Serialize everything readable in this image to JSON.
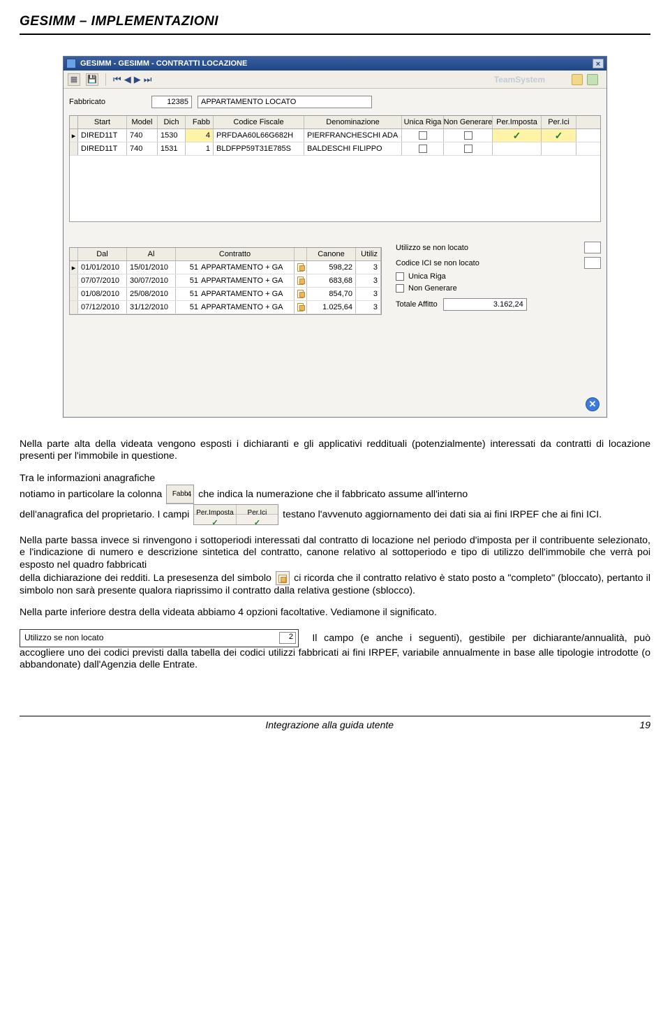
{
  "doc": {
    "header": "GESIMM – IMPLEMENTAZIONI",
    "footer_center": "Integrazione alla guida utente",
    "footer_page": "19"
  },
  "window": {
    "title": "GESIMM - GESIMM - CONTRATTI LOCAZIONE",
    "brand": "TeamSystem",
    "fabbricato_label": "Fabbricato",
    "fabbricato_code": "12385",
    "fabbricato_desc": "APPARTAMENTO LOCATO"
  },
  "grid1": {
    "head": {
      "start": "Start",
      "model": "Model",
      "dich": "Dich",
      "fabb": "Fabb",
      "cf": "Codice Fiscale",
      "denom": "Denominazione",
      "ur": "Unica Riga",
      "ng": "Non Generare",
      "pi": "Per.Imposta",
      "pici": "Per.Ici"
    },
    "rows": [
      {
        "mark": "▸",
        "start": "DIRED11T",
        "model": "740",
        "dich": "1530",
        "fabb": "4",
        "cf": "PRFDAA60L66G682H",
        "denom": "PIERFRANCHESCHI ADA",
        "ur": "☐",
        "ng": "☐",
        "pi": "✓",
        "pici": "✓",
        "hl": true
      },
      {
        "mark": "",
        "start": "DIRED11T",
        "model": "740",
        "dich": "1531",
        "fabb": "1",
        "cf": "BLDFPP59T31E785S",
        "denom": "BALDESCHI FILIPPO",
        "ur": "☐",
        "ng": "☐",
        "pi": "",
        "pici": "",
        "hl": false
      }
    ]
  },
  "grid2": {
    "head": {
      "dal": "Dal",
      "al": "Al",
      "contr": "Contratto",
      "canone": "Canone",
      "util": "Utiliz"
    },
    "rows": [
      {
        "mark": "▸",
        "dal": "01/01/2010",
        "al": "15/01/2010",
        "num": "51",
        "contr": "APPARTAMENTO + GA",
        "canone": "598,22",
        "util": "3"
      },
      {
        "mark": "",
        "dal": "07/07/2010",
        "al": "30/07/2010",
        "num": "51",
        "contr": "APPARTAMENTO + GA",
        "canone": "683,68",
        "util": "3"
      },
      {
        "mark": "",
        "dal": "01/08/2010",
        "al": "25/08/2010",
        "num": "51",
        "contr": "APPARTAMENTO + GA",
        "canone": "854,70",
        "util": "3"
      },
      {
        "mark": "",
        "dal": "07/12/2010",
        "al": "31/12/2010",
        "num": "51",
        "contr": "APPARTAMENTO + GA",
        "canone": "1.025,64",
        "util": "3"
      }
    ]
  },
  "opts": {
    "utilizzo_label": "Utilizzo se non locato",
    "codice_ici_label": "Codice ICI se non locato",
    "unica_riga_label": "Unica Riga",
    "non_generare_label": "Non Generare",
    "totale_label": "Totale Affitto",
    "totale_value": "3.162,24"
  },
  "inline": {
    "fabb_head": "Fabb",
    "fabb_val": "4",
    "perimp1": "Per.Imposta",
    "perimp2": "Per.Ici",
    "utilizzo_text": "Utilizzo se non locato",
    "utilizzo_val": "2"
  },
  "text": {
    "p1": "Nella parte alta della videata vengono esposti i dichiaranti e gli applicativi reddituali (potenzialmente) interessati da contratti di locazione presenti per l'immobile in questione.",
    "p2a": "Tra le informazioni anagrafiche",
    "p2b": "notiamo in particolare la colonna",
    "p2c": "che indica la numerazione che il fabbricato assume all'interno",
    "p2d": "dell'anagrafica del proprietario. I campi",
    "p2e": "testano l'avvenuto aggiornamento dei dati sia ai fini IRPEF che ai fini ICI.",
    "p3": "Nella parte bassa invece si rinvengono i sottoperiodi interessati dal contratto di locazione nel periodo d'imposta per il contribuente selezionato, e l'indicazione di numero e descrizione sintetica del contratto, canone relativo al sottoperiodo e tipo di utilizzo dell'immobile che verrà poi esposto nel quadro fabbricati",
    "p3b": "della dichiarazione dei redditi. La presesenza del simbolo",
    "p3c": "ci ricorda che il contratto relativo è stato posto a \"completo\" (bloccato), pertanto il simbolo non sarà presente qualora riaprissimo il contratto dalla relativa gestione (sblocco).",
    "p4": "Nella parte inferiore destra della videata abbiamo 4 opzioni facoltative. Vediamone il significato.",
    "p5": "Il campo (e anche i seguenti), gestibile per dichiarante/annualità, può accogliere uno dei codici previsti dalla tabella dei codici utilizzi fabbricati ai fini IRPEF, variabile annualmente in base alle tipologie introdotte (o abbandonate) dall'Agenzia delle Entrate."
  }
}
